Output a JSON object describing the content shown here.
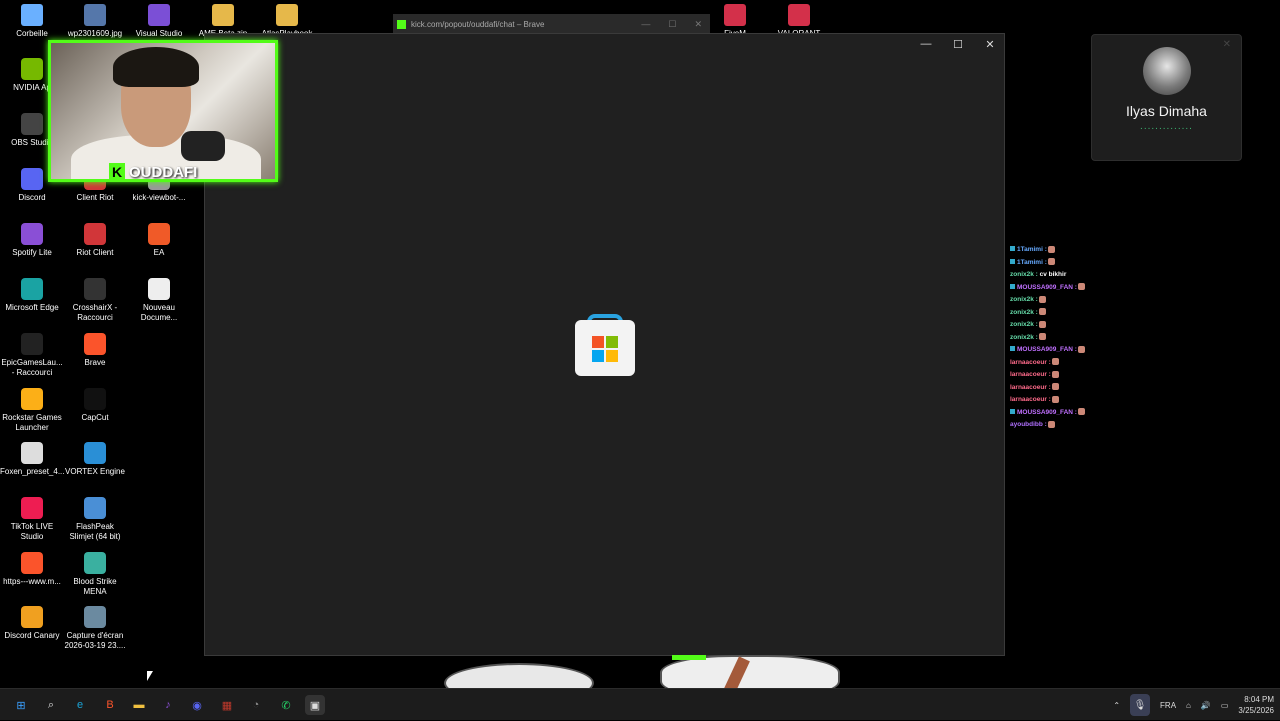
{
  "desktop": {
    "top_icons": [
      {
        "label": "Corbeille",
        "color": "#6ab0ff"
      },
      {
        "label": "wp2301609.jpg",
        "color": "#5577aa"
      },
      {
        "label": "Visual Studio",
        "color": "#7b4fd6"
      },
      {
        "label": "AME Beta.zip",
        "color": "#e6b84a"
      },
      {
        "label": "AtlasPlaybook",
        "color": "#e6b84a"
      }
    ],
    "top_right_icons": [
      {
        "label": "FiveM",
        "color": "#d3304a"
      },
      {
        "label": "VALORANT",
        "color": "#d3304a"
      }
    ],
    "icons": [
      {
        "label": "NVIDIA Ap",
        "color": "#76b900"
      },
      {
        "label": "OBS Studio",
        "color": "#444"
      },
      {
        "label": "Discord",
        "color": "#5865f2"
      },
      {
        "label": "Client Riot",
        "color": "#d13639"
      },
      {
        "label": "kick-viewbot-...",
        "color": "#999"
      },
      {
        "label": "Spotify Lite",
        "color": "#8a4fd6"
      },
      {
        "label": "Riot Client",
        "color": "#d13639"
      },
      {
        "label": "EA",
        "color": "#f05a28"
      },
      {
        "label": "Microsoft Edge",
        "color": "#1aa3a3"
      },
      {
        "label": "CrosshairX - Raccourci",
        "color": "#333"
      },
      {
        "label": "Nouveau Docume...",
        "color": "#eeeeee"
      },
      {
        "label": "EpicGamesLau... - Raccourci",
        "color": "#222"
      },
      {
        "label": "Brave",
        "color": "#fb542b"
      },
      {
        "label": "Rockstar Games Launcher",
        "color": "#fcaf17"
      },
      {
        "label": "CapCut",
        "color": "#111"
      },
      {
        "label": "Foxen_preset_4...",
        "color": "#ddd"
      },
      {
        "label": "VORTEX Engine",
        "color": "#2a8fd6"
      },
      {
        "label": "TikTok LIVE Studio",
        "color": "#ee1d52"
      },
      {
        "label": "FlashPeak Slimjet (64 bit)",
        "color": "#4a8fd6"
      },
      {
        "label": "https---www.m...",
        "color": "#fb542b"
      },
      {
        "label": "Blood Strike MENA",
        "color": "#3ab0a0"
      },
      {
        "label": "Discord Canary",
        "color": "#f0a020"
      },
      {
        "label": "Capture d'écran 2026-03-19 23....",
        "color": "#6b8aa0"
      }
    ]
  },
  "webcam": {
    "channel": "OUDDAFI",
    "logo_letter": "K"
  },
  "brave_window": {
    "title": "kick.com/popout/ouddafi/chat – Brave"
  },
  "store_window": {
    "minimize": "—",
    "maximize": "☐",
    "close": "✕"
  },
  "chat": [
    {
      "user": "1Tamimi :",
      "color": "#66aaff",
      "badge": true
    },
    {
      "user": "1Tamimi :",
      "color": "#66aaff",
      "badge": true
    },
    {
      "user": "zonix2k :",
      "color": "#66ddaa",
      "badge": false,
      "msg": "cv bikhir"
    },
    {
      "user": "MOUSSA909_FAN :",
      "color": "#c070ff",
      "badge": true
    },
    {
      "user": "zonix2k :",
      "color": "#66ddaa",
      "badge": false
    },
    {
      "user": "zonix2k :",
      "color": "#66ddaa",
      "badge": false
    },
    {
      "user": "zonix2k :",
      "color": "#66ddaa",
      "badge": false
    },
    {
      "user": "zonix2k :",
      "color": "#66ddaa",
      "badge": false
    },
    {
      "user": "MOUSSA909_FAN :",
      "color": "#c070ff",
      "badge": true
    },
    {
      "user": "larnaacoeur :",
      "color": "#ff6a8a",
      "badge": false
    },
    {
      "user": "larnaacoeur :",
      "color": "#ff6a8a",
      "badge": false
    },
    {
      "user": "larnaacoeur :",
      "color": "#ff6a8a",
      "badge": false
    },
    {
      "user": "larnaacoeur :",
      "color": "#ff6a8a",
      "badge": false
    },
    {
      "user": "MOUSSA909_FAN :",
      "color": "#c070ff",
      "badge": true
    },
    {
      "user": "ayoubdibb :",
      "color": "#b070ff",
      "badge": false
    }
  ],
  "call": {
    "name": "Ilyas Dimaha",
    "status": "..............",
    "close": "✕"
  },
  "taskbar": {
    "icons": [
      {
        "name": "start-icon",
        "glyph": "⊞",
        "color": "#3aa0ff"
      },
      {
        "name": "search-icon",
        "glyph": "⌕",
        "color": "#ddd"
      },
      {
        "name": "edge-icon",
        "glyph": "e",
        "color": "#1aa3d6"
      },
      {
        "name": "brave-icon",
        "glyph": "B",
        "color": "#fb542b"
      },
      {
        "name": "file-explorer-icon",
        "glyph": "▬",
        "color": "#f0c040"
      },
      {
        "name": "spotify-icon",
        "glyph": "♪",
        "color": "#8a4fd6"
      },
      {
        "name": "discord-icon",
        "glyph": "◉",
        "color": "#5865f2"
      },
      {
        "name": "capture-icon",
        "glyph": "▦",
        "color": "#c0392b"
      },
      {
        "name": "timer-icon",
        "glyph": "◔",
        "color": "#888"
      },
      {
        "name": "whatsapp-icon",
        "glyph": "✆",
        "color": "#25d366"
      },
      {
        "name": "store-icon",
        "glyph": "▣",
        "color": "#dddddd"
      }
    ],
    "language": "FRA",
    "time": "8:04 PM",
    "date": "3/25/2026"
  }
}
